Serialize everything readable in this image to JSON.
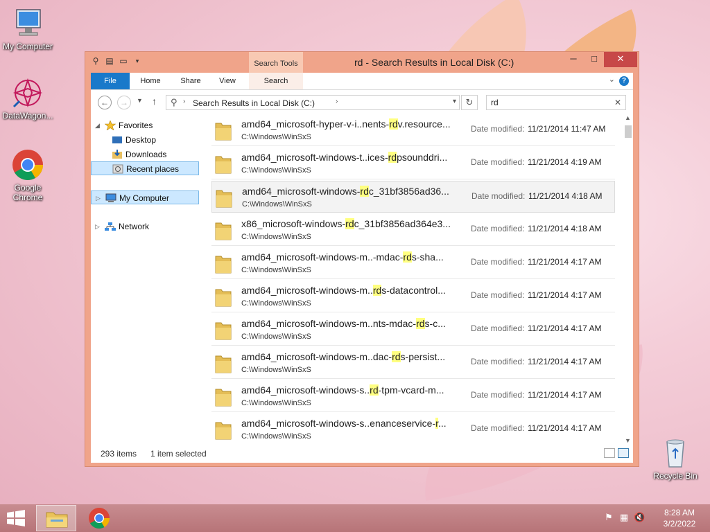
{
  "desktop": {
    "icons": [
      {
        "label": "My Computer"
      },
      {
        "label": "DataWagon..."
      },
      {
        "label": "Google Chrome"
      },
      {
        "label": "Recycle Bin"
      }
    ]
  },
  "window": {
    "title": "rd - Search Results in Local Disk (C:)",
    "context_tab_group": "Search Tools",
    "controls": {
      "minimize": "─",
      "maximize": "□",
      "close": "✕"
    },
    "ribbon_tabs": [
      "File",
      "Home",
      "Share",
      "View",
      "Search"
    ],
    "help": "?",
    "address": {
      "crumb": "Search Results in Local Disk (C:)"
    },
    "search": {
      "value": "rd",
      "placeholder": ""
    },
    "nav_pane": [
      {
        "label": "Favorites",
        "icon": "star-icon"
      },
      {
        "label": "Desktop",
        "icon": "desktop-icon"
      },
      {
        "label": "Downloads",
        "icon": "downloads-icon"
      },
      {
        "label": "Recent places",
        "icon": "recent-icon"
      },
      {
        "label": "My Computer",
        "icon": "computer-icon"
      },
      {
        "label": "Network",
        "icon": "network-icon"
      }
    ],
    "results": [
      {
        "pre": "amd64_microsoft-hyper-v-i..nents-",
        "hit": "rd",
        "post": "v.resource...",
        "path": "C:\\Windows\\WinSxS",
        "date_label": "Date modified:",
        "date": "11/21/2014 11:47 AM"
      },
      {
        "pre": "amd64_microsoft-windows-t..ices-",
        "hit": "rd",
        "post": "psounddri...",
        "path": "C:\\Windows\\WinSxS",
        "date_label": "Date modified:",
        "date": "11/21/2014 4:19 AM"
      },
      {
        "pre": "amd64_microsoft-windows-",
        "hit": "rd",
        "post": "c_31bf3856ad36...",
        "path": "C:\\Windows\\WinSxS",
        "date_label": "Date modified:",
        "date": "11/21/2014 4:18 AM"
      },
      {
        "pre": "x86_microsoft-windows-",
        "hit": "rd",
        "post": "c_31bf3856ad364e3...",
        "path": "C:\\Windows\\WinSxS",
        "date_label": "Date modified:",
        "date": "11/21/2014 4:18 AM"
      },
      {
        "pre": "amd64_microsoft-windows-m..-mdac-",
        "hit": "rd",
        "post": "s-sha...",
        "path": "C:\\Windows\\WinSxS",
        "date_label": "Date modified:",
        "date": "11/21/2014 4:17 AM"
      },
      {
        "pre": "amd64_microsoft-windows-m..",
        "hit": "rd",
        "post": "s-datacontrol...",
        "path": "C:\\Windows\\WinSxS",
        "date_label": "Date modified:",
        "date": "11/21/2014 4:17 AM"
      },
      {
        "pre": "amd64_microsoft-windows-m..nts-mdac-",
        "hit": "rd",
        "post": "s-c...",
        "path": "C:\\Windows\\WinSxS",
        "date_label": "Date modified:",
        "date": "11/21/2014 4:17 AM"
      },
      {
        "pre": "amd64_microsoft-windows-m..dac-",
        "hit": "rd",
        "post": "s-persist...",
        "path": "C:\\Windows\\WinSxS",
        "date_label": "Date modified:",
        "date": "11/21/2014 4:17 AM"
      },
      {
        "pre": "amd64_microsoft-windows-s..",
        "hit": "rd",
        "post": "-tpm-vcard-m...",
        "path": "C:\\Windows\\WinSxS",
        "date_label": "Date modified:",
        "date": "11/21/2014 4:17 AM"
      },
      {
        "pre": "amd64_microsoft-windows-s..enanceservice-",
        "hit": "r",
        "post": "...",
        "path": "C:\\Windows\\WinSxS",
        "date_label": "Date modified:",
        "date": "11/21/2014 4:17 AM"
      }
    ],
    "status": {
      "items": "293 items",
      "selected": "1 item selected"
    }
  },
  "taskbar": {
    "clock_time": "8:28 AM",
    "clock_date": "3/2/2022"
  },
  "colors": {
    "accent": "#1979ca",
    "window_frame": "#f0a48a",
    "close": "#c74848",
    "highlight": "#ffff80"
  }
}
